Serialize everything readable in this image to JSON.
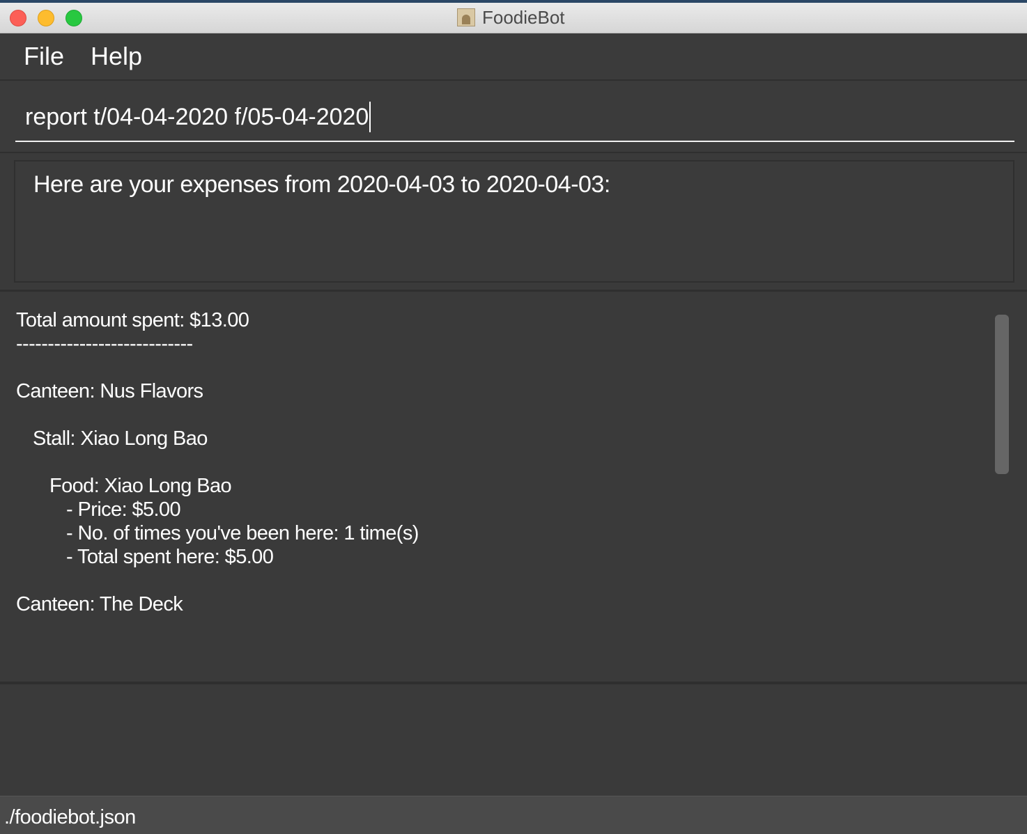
{
  "window": {
    "title": "FoodieBot"
  },
  "menu": {
    "file": "File",
    "help": "Help"
  },
  "command": {
    "value": "report t/04-04-2020 f/05-04-2020"
  },
  "result": {
    "message": "Here are your expenses from 2020-04-03 to 2020-04-03:"
  },
  "report": {
    "total": "Total amount spent: $13.00",
    "separator": "----------------------------",
    "canteen1": "Canteen: Nus Flavors",
    "stall1": "Stall: Xiao Long Bao",
    "food1": "Food: Xiao Long Bao",
    "price1": "- Price: $5.00",
    "visits1": "- No. of times you've been here: 1 time(s)",
    "spent1": "- Total spent here: $5.00",
    "canteen2": "Canteen: The Deck"
  },
  "status": {
    "file_path": "./foodiebot.json"
  }
}
